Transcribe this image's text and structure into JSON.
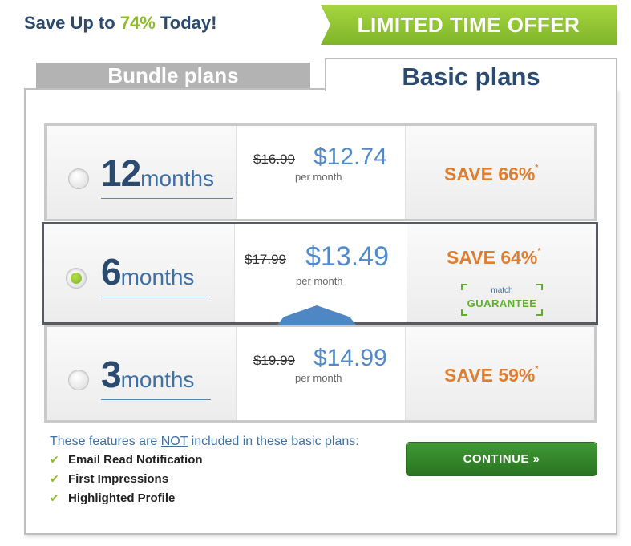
{
  "header": {
    "headline_prefix": "Save Up to ",
    "headline_pct": "74%",
    "headline_suffix": " Today!",
    "offer_banner": "LIMITED TIME OFFER"
  },
  "tabs": {
    "bundle": "Bundle plans",
    "basic": "Basic plans",
    "active": "Basic plans"
  },
  "plans": [
    {
      "number": "12",
      "unit": "months",
      "old_price": "$16.99",
      "new_price": "$12.74",
      "per": "per month",
      "save": "SAVE 66%",
      "asterisk": "*",
      "selected": false
    },
    {
      "number": "6",
      "unit": "months",
      "old_price": "$17.99",
      "new_price": "$13.49",
      "per": "per month",
      "save": "SAVE 64%",
      "asterisk": "*",
      "selected": true,
      "guarantee_brand": "match",
      "guarantee_text": "GUARANTEE"
    },
    {
      "number": "3",
      "unit": "months",
      "old_price": "$19.99",
      "new_price": "$14.99",
      "per": "per month",
      "save": "SAVE 59%",
      "asterisk": "*",
      "selected": false
    }
  ],
  "features": {
    "title_prefix": "These features are ",
    "title_not": "NOT",
    "title_suffix": " included in these basic plans:",
    "items": [
      "Email Read Notification",
      "First Impressions",
      "Highlighted Profile"
    ]
  },
  "continue_label": "CONTINUE »",
  "colors": {
    "brand_navy": "#2b4a6f",
    "accent_green": "#8dbb2c",
    "price_blue": "#4f8ad0",
    "save_orange": "#e07d2e",
    "button_green": "#3f9a33"
  },
  "icons": {
    "check": "check-icon",
    "radio": "radio-icon"
  }
}
